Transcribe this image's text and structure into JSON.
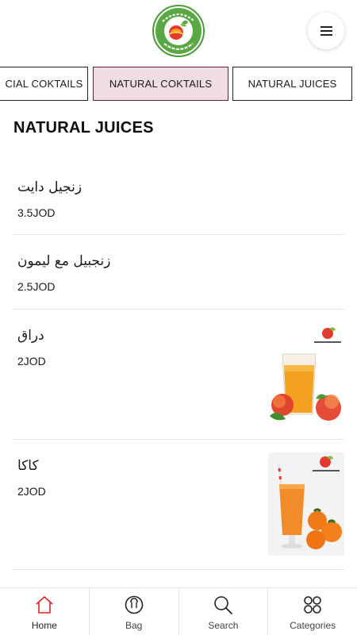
{
  "header": {
    "logo": {
      "name": "Fruit Paradise",
      "arabic": "جنة الفواكه",
      "colors": {
        "ring": "#4a9a3a",
        "fruit": "#e23b2e",
        "leaf": "#7dc043"
      }
    },
    "menu_icon": "hamburger-icon"
  },
  "tabs": [
    {
      "label": "CIAL COKTAILS",
      "active": false
    },
    {
      "label": "NATURAL COKTAILS",
      "active": true
    },
    {
      "label": "NATURAL JUICES",
      "active": false
    }
  ],
  "section": {
    "title": "NATURAL JUICES"
  },
  "items": [
    {
      "name": "زنجيل دايت",
      "price": "3.5JOD",
      "has_image": false
    },
    {
      "name": "زنجبيل مع ليمون",
      "price": "2.5JOD",
      "has_image": false
    },
    {
      "name": "دراق",
      "price": "2JOD",
      "has_image": true,
      "image": "peach-juice-photo"
    },
    {
      "name": "كاكا",
      "price": "2JOD",
      "has_image": true,
      "image": "persimmon-juice-photo"
    }
  ],
  "bottom_nav": [
    {
      "label": "Home",
      "icon": "home-icon",
      "active": true
    },
    {
      "label": "Bag",
      "icon": "bag-icon",
      "active": false
    },
    {
      "label": "Search",
      "icon": "search-icon",
      "active": false
    },
    {
      "label": "Categories",
      "icon": "categories-icon",
      "active": false
    }
  ],
  "colors": {
    "accent": "#e02424",
    "active_tab_bg": "#f0dde4",
    "active_tab_border": "#7a1a2e"
  }
}
